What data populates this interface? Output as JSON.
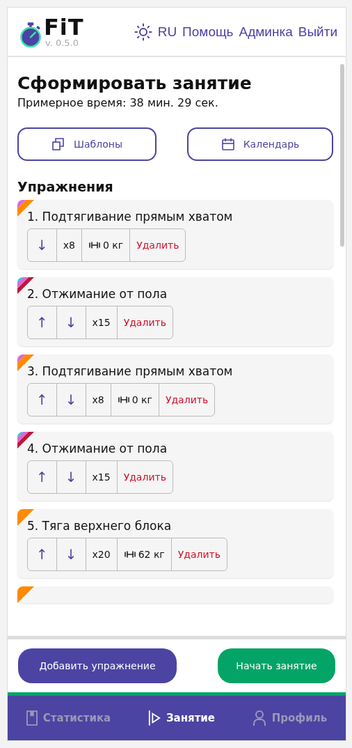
{
  "header": {
    "logo": "FiT",
    "version": "v. 0.5.0",
    "links": [
      "RU",
      "Помощь",
      "Админка",
      "Выйти"
    ]
  },
  "title": "Сформировать занятие",
  "estimate": "Примерное время: 38 мин. 29 сек.",
  "actions": [
    {
      "kind": "templates",
      "label": "Шаблоны"
    },
    {
      "kind": "calendar",
      "label": "Календарь"
    }
  ],
  "section": "Упражнения",
  "exercises": [
    {
      "title": "1. Подтягивание прямым хватом",
      "tags": [
        {
          "color": "#ff8a00"
        },
        {
          "color": "#d96ad6"
        }
      ],
      "controls": [
        {
          "kind": "down",
          "text": "↓"
        },
        {
          "kind": "reps",
          "text": "x8"
        },
        {
          "kind": "weight",
          "text": "0 кг"
        },
        {
          "kind": "delete",
          "text": "Удалить"
        }
      ]
    },
    {
      "title": "2. Отжимание от пола",
      "tags": [
        {
          "color": "#c0163b"
        },
        {
          "color": "#d96ad6"
        },
        {
          "color": "#19cdd0"
        }
      ],
      "controls": [
        {
          "kind": "up",
          "text": "↑"
        },
        {
          "kind": "down",
          "text": "↓"
        },
        {
          "kind": "reps",
          "text": "x15"
        },
        {
          "kind": "delete",
          "text": "Удалить"
        }
      ]
    },
    {
      "title": "3. Подтягивание прямым хватом",
      "tags": [
        {
          "color": "#ff8a00"
        },
        {
          "color": "#d96ad6"
        }
      ],
      "controls": [
        {
          "kind": "up",
          "text": "↑"
        },
        {
          "kind": "down",
          "text": "↓"
        },
        {
          "kind": "reps",
          "text": "x8"
        },
        {
          "kind": "weight",
          "text": "0 кг"
        },
        {
          "kind": "delete",
          "text": "Удалить"
        }
      ]
    },
    {
      "title": "4. Отжимание от пола",
      "tags": [
        {
          "color": "#c0163b"
        },
        {
          "color": "#d96ad6"
        },
        {
          "color": "#19cdd0"
        }
      ],
      "controls": [
        {
          "kind": "up",
          "text": "↑"
        },
        {
          "kind": "down",
          "text": "↓"
        },
        {
          "kind": "reps",
          "text": "x15"
        },
        {
          "kind": "delete",
          "text": "Удалить"
        }
      ]
    },
    {
      "title": "5. Тяга верхнего блока",
      "tags": [
        {
          "color": "#ff8a00"
        }
      ],
      "controls": [
        {
          "kind": "up",
          "text": "↑"
        },
        {
          "kind": "down",
          "text": "↓"
        },
        {
          "kind": "reps",
          "text": "x20"
        },
        {
          "kind": "weight",
          "text": "62 кг"
        },
        {
          "kind": "delete",
          "text": "Удалить"
        }
      ]
    },
    {
      "tags": [
        {
          "color": "#ff8a00"
        }
      ]
    }
  ],
  "footer_buttons": [
    {
      "kind": "add",
      "label": "Добавить упражнение"
    },
    {
      "kind": "start",
      "label": "Начать занятие"
    }
  ],
  "nav": [
    {
      "kind": "stats",
      "label": "Статистика",
      "selected": false
    },
    {
      "kind": "session",
      "label": "Занятие",
      "selected": true
    },
    {
      "kind": "profile",
      "label": "Профиль",
      "selected": false
    }
  ]
}
